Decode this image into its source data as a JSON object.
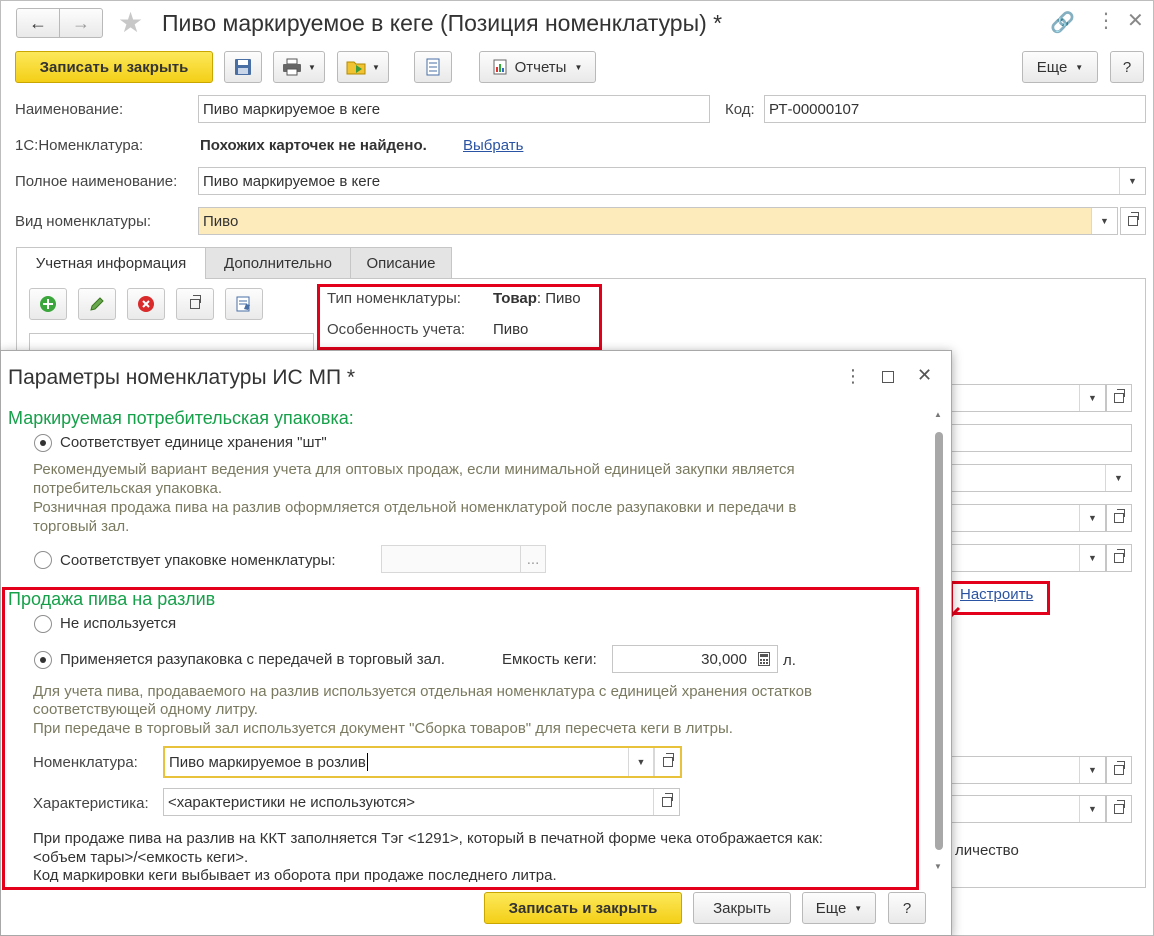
{
  "window": {
    "title": "Пиво маркируемое в кеге (Позиция номенклатуры) *"
  },
  "toolbar": {
    "save_close": "Записать и закрыть",
    "reports": "Отчеты",
    "more": "Еще",
    "help": "?"
  },
  "form": {
    "name_label": "Наименование:",
    "name_value": "Пиво маркируемое в кеге",
    "code_label": "Код:",
    "code_value": "РТ-00000107",
    "nom1c_label": "1С:Номенклатура:",
    "nom1c_text": "Похожих карточек не найдено.",
    "nom1c_link": "Выбрать",
    "fullname_label": "Полное наименование:",
    "fullname_value": "Пиво маркируемое в кеге",
    "kind_label": "Вид номенклатуры:",
    "kind_value": "Пиво"
  },
  "tabs": [
    "Учетная информация",
    "Дополнительно",
    "Описание"
  ],
  "info": {
    "type_label": "Тип номенклатуры:",
    "type_value_bold": "Товар",
    "type_value_rest": ": Пиво",
    "feature_label": "Особенность учета:",
    "feature_value": "Пиво"
  },
  "background": {
    "configure_link": "Настроить",
    "quantity_fragment": "личество"
  },
  "dialog": {
    "title": "Параметры номенклатуры ИС МП *",
    "section1_title": "Маркируемая потребительская упаковка:",
    "opt1": "Соответствует единице хранения \"шт\"",
    "opt1_hint_1": "Рекомендуемый вариант ведения учета для оптовых продаж, если минимальной единицей закупки является",
    "opt1_hint_2": "потребительская упаковка.",
    "opt1_hint_3": "Розничная продажа пива на разлив оформляется отдельной номенклатурой после разупаковки и передачи в",
    "opt1_hint_4": "торговый зал.",
    "opt2": "Соответствует упаковке номенклатуры:",
    "opt2_btn": "...",
    "section2_title": "Продажа пива на разлив",
    "opt3": "Не используется",
    "opt4": "Применяется разупаковка с передачей в торговый зал.",
    "keg_label": "Емкость кеги:",
    "keg_value": "30,000",
    "keg_unit": "л.",
    "opt4_hint_1": "Для учета пива, продаваемого на разлив используется отдельная номенклатура с единицей хранения остатков",
    "opt4_hint_2": "соответствующей одному литру.",
    "opt4_hint_3": "При передаче в торговый зал используется документ \"Сборка товаров\" для пересчета кеги в литры.",
    "nom_label": "Номенклатура:",
    "nom_value": "Пиво маркируемое в розлив",
    "char_label": "Характеристика:",
    "char_value": "<характеристики не используются>",
    "note_1": "При продаже пива на разлив на ККТ заполняется Тэг <1291>, который в печатной форме чека отображается как:",
    "note_2": "<объем тары>/<емкость кеги>.",
    "note_3": "Код маркировки кеги выбывает из оборота при продаже последнего литра.",
    "save_close": "Записать и закрыть",
    "close": "Закрыть",
    "more": "Еще",
    "help": "?"
  }
}
